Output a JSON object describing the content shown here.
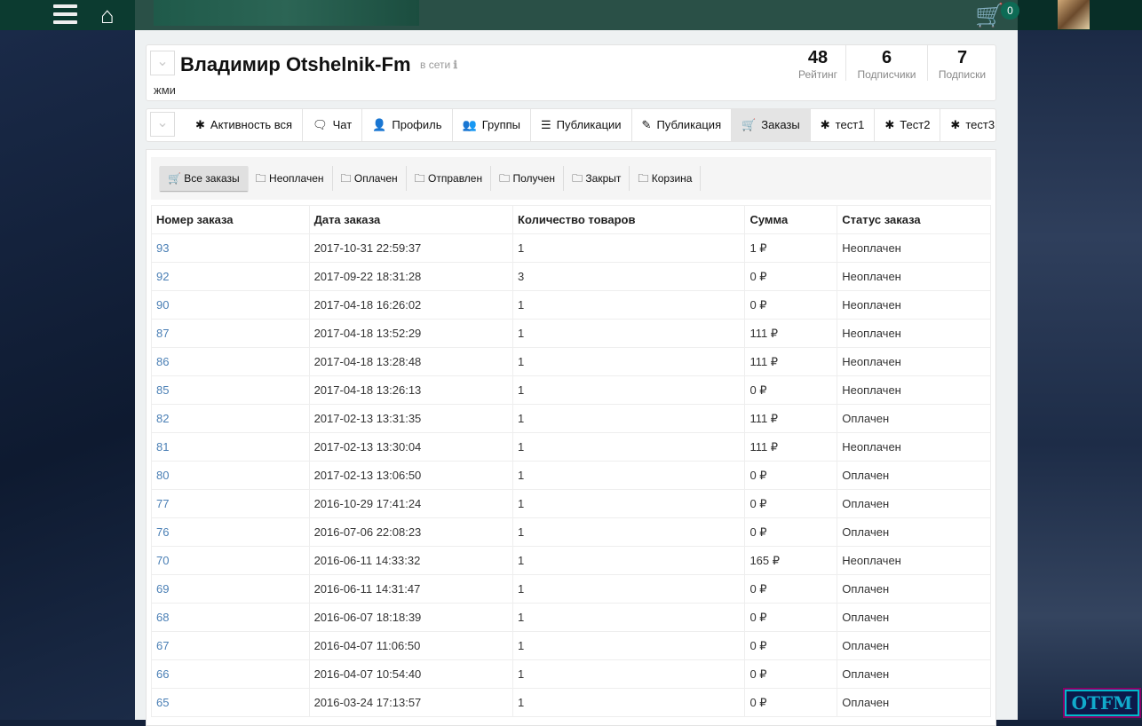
{
  "topbar": {
    "cart_count": "0"
  },
  "profile": {
    "name": "Владимир Otshelnik-Fm",
    "online": "в сети",
    "status": "жми",
    "stats": [
      {
        "value": "48",
        "label": "Рейтинг"
      },
      {
        "value": "6",
        "label": "Подписчики"
      },
      {
        "value": "7",
        "label": "Подписки"
      }
    ]
  },
  "tabs": [
    {
      "icon": "gear-icon",
      "g": "✱",
      "label": "Активность вся"
    },
    {
      "icon": "chat-icon",
      "g": "🗨",
      "label": "Чат"
    },
    {
      "icon": "user-icon",
      "g": "👤",
      "label": "Профиль"
    },
    {
      "icon": "users-icon",
      "g": "👥",
      "label": "Группы"
    },
    {
      "icon": "list-icon",
      "g": "☰",
      "label": "Публикации"
    },
    {
      "icon": "pencil-icon",
      "g": "✎",
      "label": "Публикация"
    },
    {
      "icon": "cart-icon",
      "g": "🛒",
      "label": "Заказы",
      "active": true
    },
    {
      "icon": "gear-icon",
      "g": "✱",
      "label": "тест1"
    },
    {
      "icon": "gear-icon",
      "g": "✱",
      "label": "Тест2"
    },
    {
      "icon": "gear-icon",
      "g": "✱",
      "label": "тест3"
    }
  ],
  "filters": [
    "Все заказы",
    "Неоплачен",
    "Оплачен",
    "Отправлен",
    "Получен",
    "Закрыт",
    "Корзина"
  ],
  "table": {
    "headers": [
      "Номер заказа",
      "Дата заказа",
      "Количество товаров",
      "Сумма",
      "Статус заказа"
    ],
    "rows": [
      [
        "93",
        "2017-10-31 22:59:37",
        "1",
        "1 ₽",
        "Неоплачен"
      ],
      [
        "92",
        "2017-09-22 18:31:28",
        "3",
        "0 ₽",
        "Неоплачен"
      ],
      [
        "90",
        "2017-04-18 16:26:02",
        "1",
        "0 ₽",
        "Неоплачен"
      ],
      [
        "87",
        "2017-04-18 13:52:29",
        "1",
        "111 ₽",
        "Неоплачен"
      ],
      [
        "86",
        "2017-04-18 13:28:48",
        "1",
        "111 ₽",
        "Неоплачен"
      ],
      [
        "85",
        "2017-04-18 13:26:13",
        "1",
        "0 ₽",
        "Неоплачен"
      ],
      [
        "82",
        "2017-02-13 13:31:35",
        "1",
        "111 ₽",
        "Оплачен"
      ],
      [
        "81",
        "2017-02-13 13:30:04",
        "1",
        "111 ₽",
        "Неоплачен"
      ],
      [
        "80",
        "2017-02-13 13:06:50",
        "1",
        "0 ₽",
        "Оплачен"
      ],
      [
        "77",
        "2016-10-29 17:41:24",
        "1",
        "0 ₽",
        "Оплачен"
      ],
      [
        "76",
        "2016-07-06 22:08:23",
        "1",
        "0 ₽",
        "Оплачен"
      ],
      [
        "70",
        "2016-06-11 14:33:32",
        "1",
        "165 ₽",
        "Неоплачен"
      ],
      [
        "69",
        "2016-06-11 14:31:47",
        "1",
        "0 ₽",
        "Оплачен"
      ],
      [
        "68",
        "2016-06-07 18:18:39",
        "1",
        "0 ₽",
        "Оплачен"
      ],
      [
        "67",
        "2016-04-07 11:06:50",
        "1",
        "0 ₽",
        "Оплачен"
      ],
      [
        "66",
        "2016-04-07 10:54:40",
        "1",
        "0 ₽",
        "Оплачен"
      ],
      [
        "65",
        "2016-03-24 17:13:57",
        "1",
        "0 ₽",
        "Оплачен"
      ]
    ]
  },
  "logo": "OTFM"
}
